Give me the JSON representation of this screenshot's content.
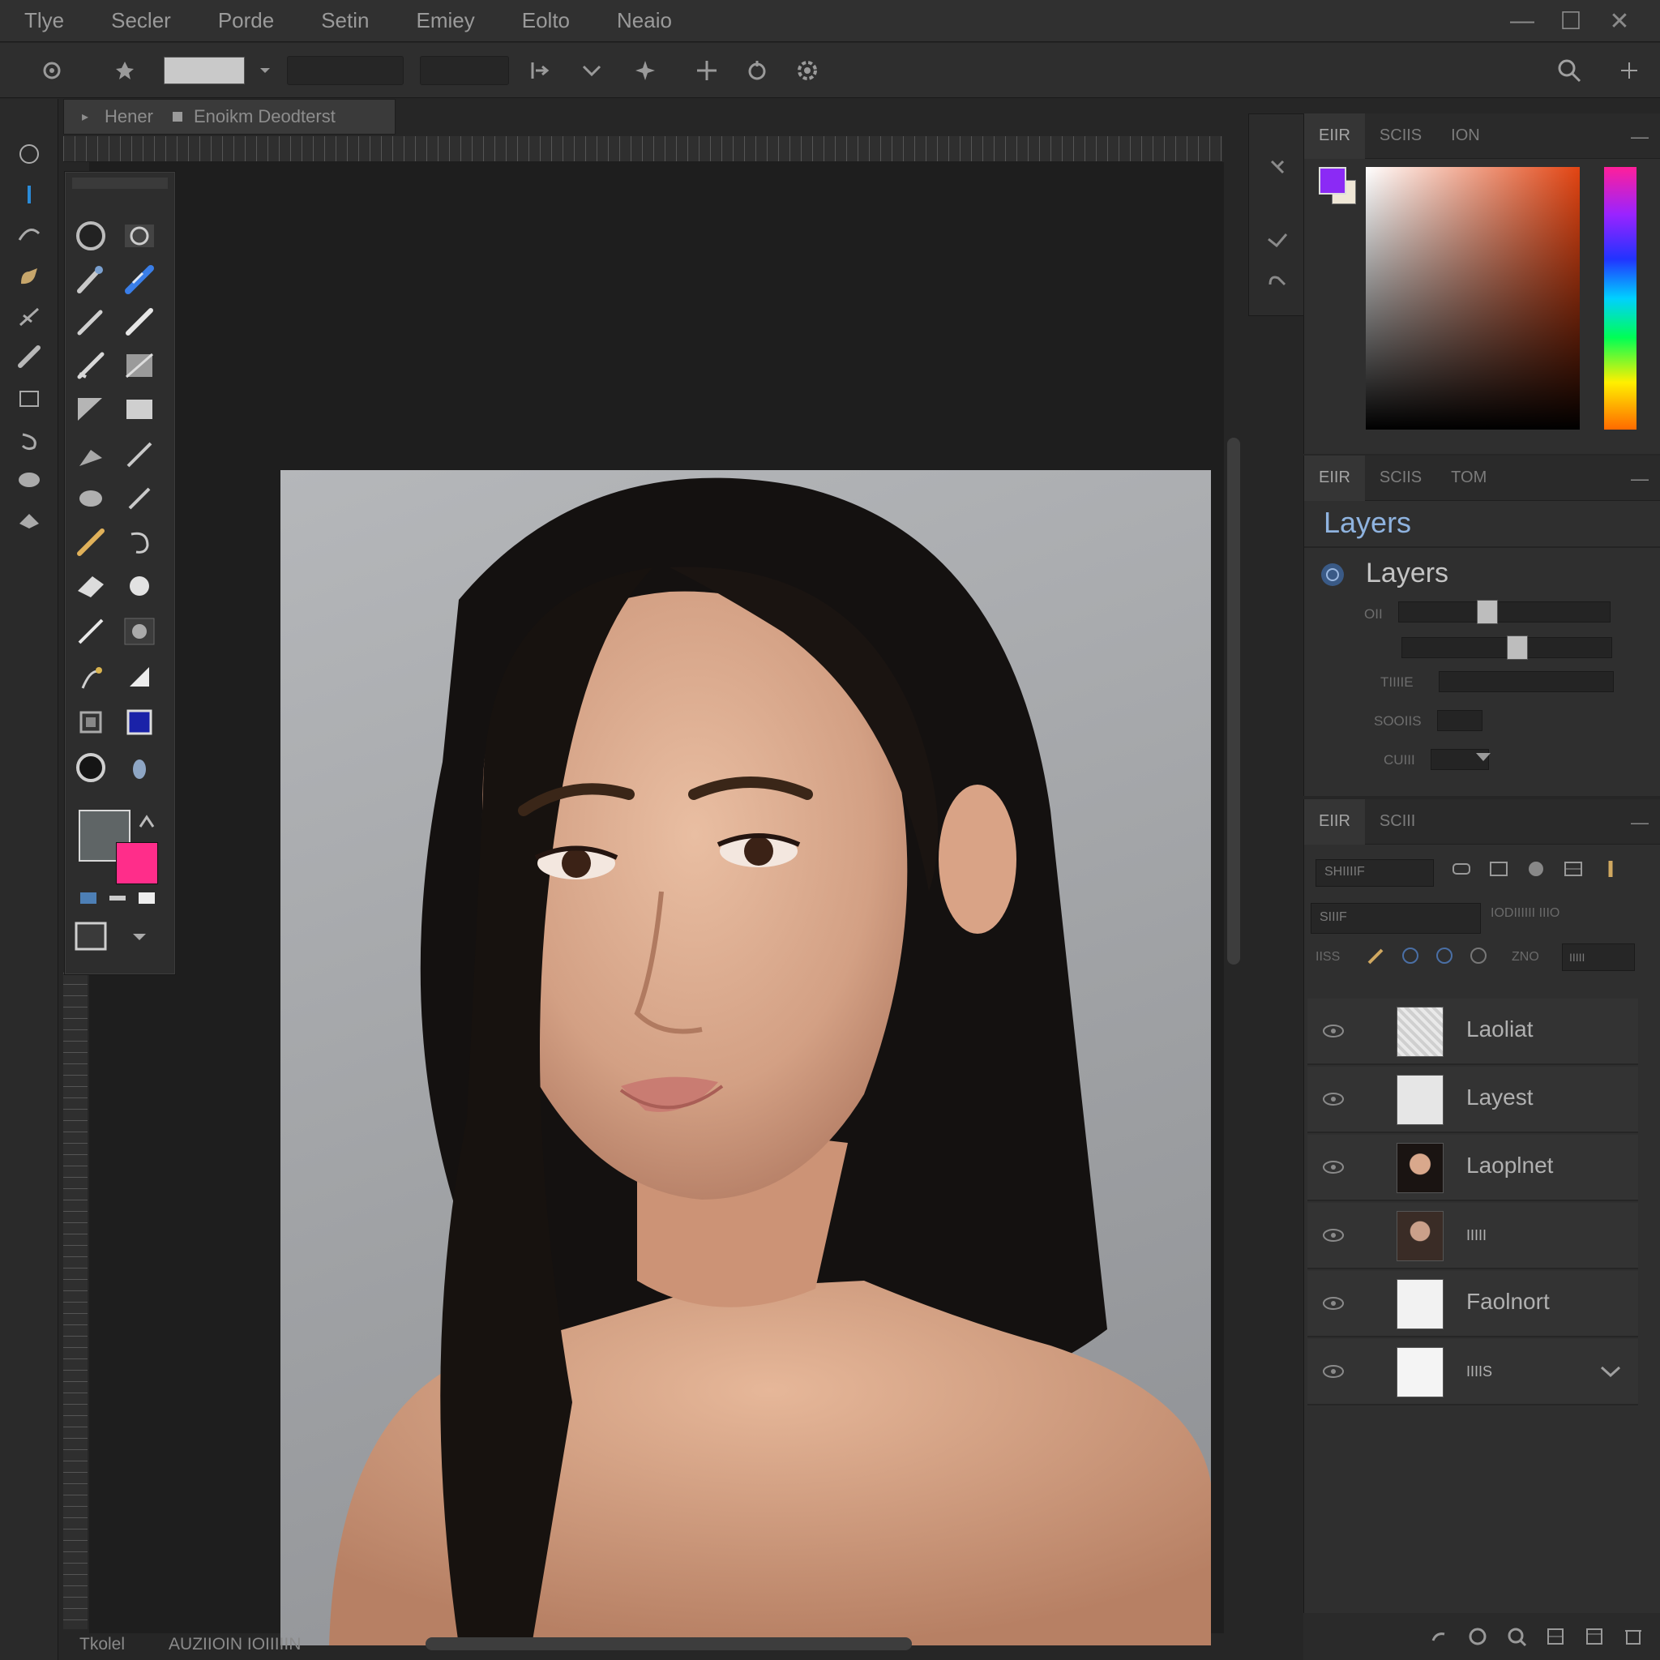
{
  "menu": [
    "Tlye",
    "Secler",
    "Porde",
    "Setin",
    "Emiey",
    "Eolto",
    "Neaio"
  ],
  "window_controls": {
    "minimize": "—",
    "maximize": "☐",
    "close": "✕"
  },
  "doc_tab": {
    "label": "Hener",
    "document": "Enoikm Deodterst"
  },
  "color_panel": {
    "tabs": [
      "EIIR",
      "SCIIS",
      "ION"
    ],
    "fg": "#8b2af5",
    "bg": "#efe7d6"
  },
  "layers_panel": {
    "tabs": [
      "EIIR",
      "SCIIS",
      "TOM"
    ],
    "header": "Layers",
    "sub_header": "Layers",
    "props": [
      {
        "label": "OII",
        "value": 0.42
      },
      {
        "label": "",
        "value": 0.55
      },
      {
        "label": "TIIIIE",
        "value": null
      },
      {
        "label": "SOOIIS",
        "value": null
      },
      {
        "label": "CUIII",
        "value": null
      }
    ]
  },
  "layer_list_panel": {
    "tabs": [
      "EIIR",
      "SCIII"
    ],
    "blend_mode": "SHIIIIF",
    "filter_mode": "SIIIF",
    "opacity_label": "IODIIIIII IIIO",
    "lock_label": "IISS",
    "fill_label": "ZNO",
    "fill_select": "IIIII",
    "layers": [
      {
        "name": "Laoliat",
        "thumb": "texture"
      },
      {
        "name": "Layest",
        "thumb": "paper"
      },
      {
        "name": "Laoplnet",
        "thumb": "portrait-a"
      },
      {
        "name": "IIIII",
        "thumb": "portrait-b"
      },
      {
        "name": "Faolnort",
        "thumb": "white"
      },
      {
        "name": "IIIIS",
        "thumb": "white"
      }
    ]
  },
  "status": {
    "zoom": "Tkolel",
    "info": "AUZIIOIN IOIIIIIN"
  }
}
